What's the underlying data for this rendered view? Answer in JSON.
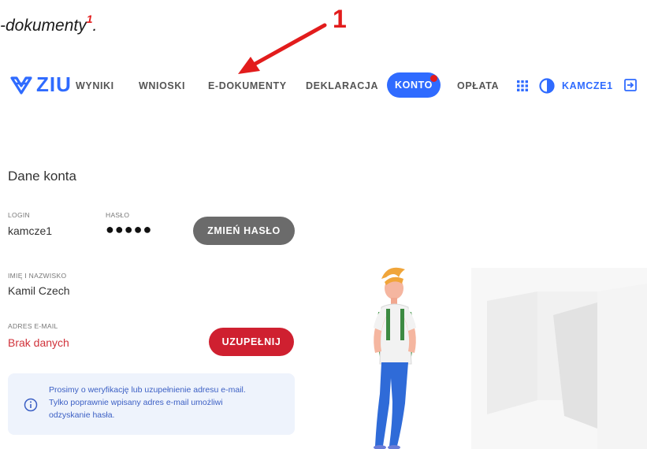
{
  "caption": {
    "text": "-dokumenty",
    "superscript": "1",
    "suffix": "."
  },
  "marker": {
    "number": "1",
    "color": "#e21c1c"
  },
  "nav": {
    "logo_text": "ZIU",
    "items": [
      "WYNIKI",
      "WNIOSKI",
      "E-DOKUMENTY",
      "DEKLARACJA",
      "KONTO",
      "OPŁATA"
    ],
    "active": "KONTO",
    "user": "KAMCZE1",
    "accent": "#2f6bff"
  },
  "account": {
    "title": "Dane konta",
    "login_label": "LOGIN",
    "login_value": "kamcze1",
    "password_label": "HASŁO",
    "password_value": "●●●●●",
    "change_password_button": "ZMIEŃ HASŁO",
    "name_label": "IMIĘ I NAZWISKO",
    "name_value": "Kamil Czech",
    "email_label": "ADRES E-MAIL",
    "email_value": "Brak danych",
    "complete_button": "UZUPEŁNIJ",
    "info_lines": [
      "Prosimy o weryfikację lub uzupełnienie adresu e-mail.",
      "Tylko poprawnie wpisany adres e-mail umożliwi",
      "odzyskanie hasła."
    ]
  }
}
